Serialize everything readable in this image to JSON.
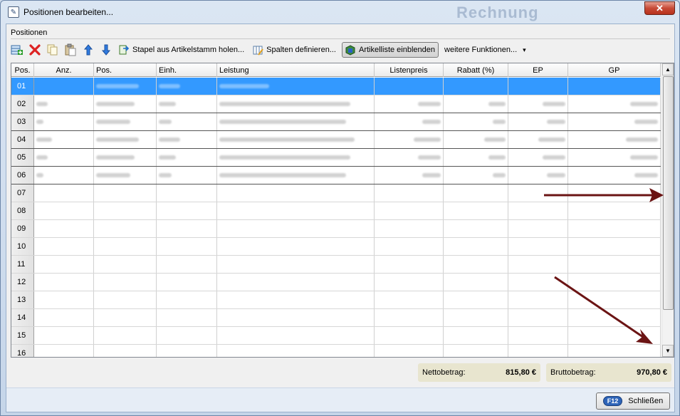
{
  "window": {
    "title": "Positionen bearbeiten...",
    "background_title": "Rechnung",
    "close_glyph": "✕"
  },
  "section": {
    "label": "Positionen"
  },
  "toolbar": {
    "icons": [
      "add-row-icon",
      "delete-icon",
      "copy-icon",
      "paste-icon",
      "move-up-icon",
      "move-down-icon"
    ],
    "stapel_label": "Stapel aus Artikelstamm holen...",
    "spalten_label": "Spalten definieren...",
    "artikelliste_label": "Artikelliste einblenden",
    "weitere_label": "weitere Funktionen...",
    "weitere_arrow": "▾"
  },
  "grid": {
    "columns": [
      "Pos.",
      "Anz.",
      "Pos.",
      "Einh.",
      "Leistung",
      "Listenpreis",
      "Rabatt (%)",
      "EP",
      "GP"
    ],
    "rows": [
      "01",
      "02",
      "03",
      "04",
      "05",
      "06",
      "07",
      "08",
      "09",
      "10",
      "11",
      "12",
      "13",
      "14",
      "15",
      "16"
    ],
    "selected_row": 0
  },
  "scrollbar": {
    "up": "▲",
    "down": "▼"
  },
  "totals": {
    "netto_label": "Nettobetrag:",
    "netto_value": "815,80 €",
    "brutto_label": "Bruttobetrag:",
    "brutto_value": "970,80 €"
  },
  "footer": {
    "f12_key": "F12",
    "close_label": "Schließen"
  },
  "colors": {
    "selection": "#3399ff",
    "annotation_arrow": "#6b1414",
    "close_button": "#c74a36"
  }
}
